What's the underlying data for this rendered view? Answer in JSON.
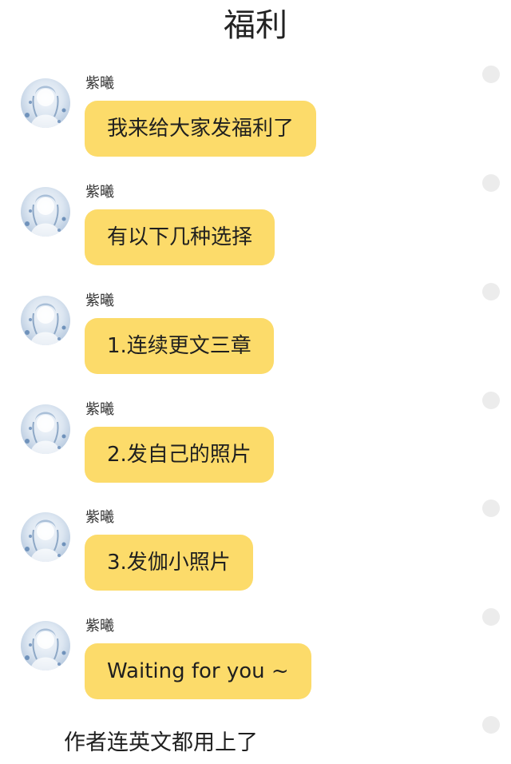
{
  "header": {
    "title": "福利"
  },
  "messages": [
    {
      "sender": "紫曦",
      "text": "我来给大家发福利了"
    },
    {
      "sender": "紫曦",
      "text": "有以下几种选择"
    },
    {
      "sender": "紫曦",
      "text": "1.连续更文三章"
    },
    {
      "sender": "紫曦",
      "text": "2.发自己的照片"
    },
    {
      "sender": "紫曦",
      "text": "3.发伽小照片"
    },
    {
      "sender": "紫曦",
      "text": "Waiting for you ~"
    }
  ],
  "caption": "作者连英文都用上了",
  "colors": {
    "bubble": "#fcdb6a",
    "status_dot": "#ececec",
    "avatar_tint": "#b9cbe0"
  },
  "icons": {
    "avatar": "anime-avatar",
    "status": "status-dot-icon"
  }
}
